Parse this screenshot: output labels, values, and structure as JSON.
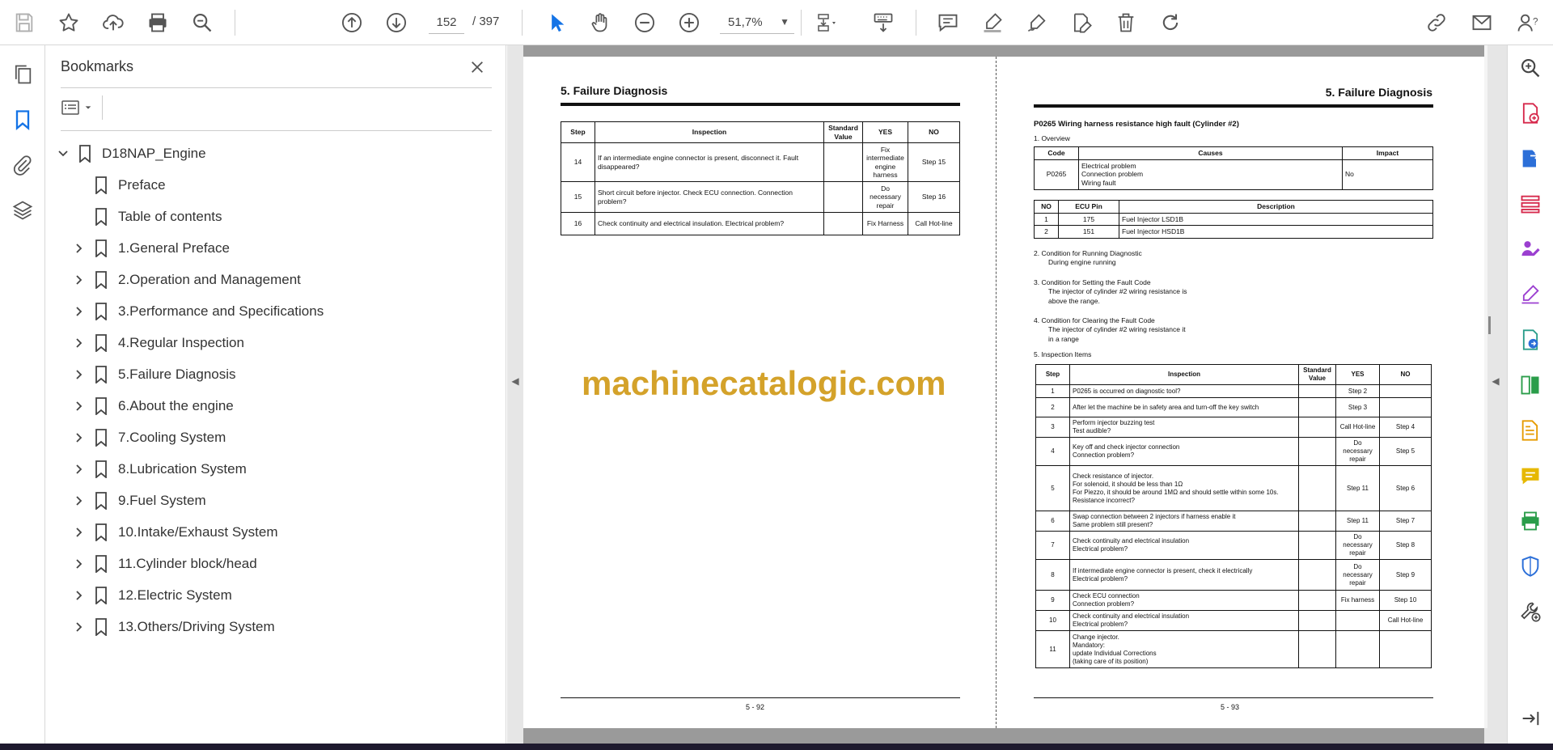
{
  "toolbar": {
    "page_current": "152",
    "page_total": "/  397",
    "zoom": "51,7%"
  },
  "bookmarks": {
    "title": "Bookmarks",
    "items": [
      {
        "label": "D18NAP_Engine",
        "expanded": true,
        "level": 0
      },
      {
        "label": "Preface",
        "level": 1
      },
      {
        "label": "Table of contents",
        "level": 1
      },
      {
        "label": "1.General Preface",
        "level": 1,
        "expandable": true
      },
      {
        "label": "2.Operation and Management",
        "level": 1,
        "expandable": true
      },
      {
        "label": "3.Performance and Specifications",
        "level": 1,
        "expandable": true
      },
      {
        "label": "4.Regular Inspection",
        "level": 1,
        "expandable": true
      },
      {
        "label": "5.Failure Diagnosis",
        "level": 1,
        "expandable": true
      },
      {
        "label": "6.About the engine",
        "level": 1,
        "expandable": true
      },
      {
        "label": "7.Cooling System",
        "level": 1,
        "expandable": true
      },
      {
        "label": "8.Lubrication System",
        "level": 1,
        "expandable": true
      },
      {
        "label": "9.Fuel System",
        "level": 1,
        "expandable": true
      },
      {
        "label": "10.Intake/Exhaust System",
        "level": 1,
        "expandable": true
      },
      {
        "label": "11.Cylinder block/head",
        "level": 1,
        "expandable": true
      },
      {
        "label": "12.Electric System",
        "level": 1,
        "expandable": true
      },
      {
        "label": "13.Others/Driving System",
        "level": 1,
        "expandable": true
      }
    ]
  },
  "left_page": {
    "title": "5. Failure Diagnosis",
    "headers": [
      "Step",
      "Inspection",
      "Standard Value",
      "YES",
      "NO"
    ],
    "rows": [
      {
        "step": "14",
        "inspection": "If an intermediate engine connector is present, disconnect it. Fault disappeared?",
        "std": "",
        "yes": "Fix intermediate engine harness",
        "no": "Step 15"
      },
      {
        "step": "15",
        "inspection": "Short circuit before injector. Check ECU connection. Connection problem?",
        "std": "",
        "yes": "Do necessary repair",
        "no": "Step 16"
      },
      {
        "step": "16",
        "inspection": "Check continuity and electrical insulation. Electrical problem?",
        "std": "",
        "yes": "Fix Harness",
        "no": "Call Hot-line"
      }
    ],
    "page_number": "5 - 92"
  },
  "right_page": {
    "title": "5. Failure Diagnosis",
    "subtitle": "P0265 Wiring harness resistance high fault (Cylinder #2)",
    "overview_label": "1.  Overview",
    "code_table": {
      "headers": [
        "Code",
        "Causes",
        "Impact"
      ],
      "code": "P0265",
      "causes": [
        "Electrical problem",
        "Connection problem",
        "Wiring fault"
      ],
      "impact": "No"
    },
    "pin_table": {
      "headers": [
        "NO",
        "ECU Pin",
        "Description"
      ],
      "rows": [
        {
          "no": "1",
          "pin": "175",
          "desc": "Fuel Injector LSD1B"
        },
        {
          "no": "2",
          "pin": "151",
          "desc": "Fuel Injector HSD1B"
        }
      ]
    },
    "cond_running": [
      "2.  Condition for Running Diagnostic",
      "During engine running"
    ],
    "cond_setting": [
      "3.  Condition for Setting the Fault Code",
      "The injector of cylinder #2 wiring resistance is",
      "above the range."
    ],
    "cond_clearing": [
      "4.  Condition for Clearing the Fault Code",
      "The injector of cylinder #2 wiring resistance it",
      "in a range"
    ],
    "inspection_label": "5.  Inspection Items",
    "inspection_headers": [
      "Step",
      "Inspection",
      "Standard Value",
      "YES",
      "NO"
    ],
    "inspection_rows": [
      {
        "step": "1",
        "inspection": "P0265 is occurred on diagnostic tool?",
        "std": "",
        "yes": "Step 2",
        "no": ""
      },
      {
        "step": "2",
        "inspection": "After let the machine be in safety area and turn-off the key switch",
        "std": "",
        "yes": "Step 3",
        "no": ""
      },
      {
        "step": "3",
        "inspection": "Perform injector buzzing test\nTest audible?",
        "std": "",
        "yes": "Call Hot-line",
        "no": "Step 4"
      },
      {
        "step": "4",
        "inspection": "Key off and check injector connection\nConnection problem?",
        "std": "",
        "yes": "Do necessary repair",
        "no": "Step 5"
      },
      {
        "step": "5",
        "inspection": "Check resistance of injector.\nFor solenoid, it should be less than 1Ω\nFor Piezzo, it should be around 1MΩ and should settle within some 10s.\nResistance incorrect?",
        "std": "",
        "yes": "Step 11",
        "no": "Step 6"
      },
      {
        "step": "6",
        "inspection": "Swap connection between 2 injectors if harness enable it\nSame problem still present?",
        "std": "",
        "yes": "Step 11",
        "no": "Step 7"
      },
      {
        "step": "7",
        "inspection": "Check continuity and electrical insulation\nElectrical problem?",
        "std": "",
        "yes": "Do necessary repair",
        "no": "Step 8"
      },
      {
        "step": "8",
        "inspection": "If intermediate engine connector is present, check it electrically\nElectrical problem?",
        "std": "",
        "yes": "Do necessary repair",
        "no": "Step 9"
      },
      {
        "step": "9",
        "inspection": "Check ECU connection\nConnection problem?",
        "std": "",
        "yes": "Fix harness",
        "no": "Step 10"
      },
      {
        "step": "10",
        "inspection": "Check continuity and electrical insulation\nElectrical problem?",
        "std": "",
        "yes": "",
        "no": "Call Hot-line"
      },
      {
        "step": "11",
        "inspection": "Change injector.\nMandatory:\nupdate Individual Corrections\n(taking care of its position)",
        "std": "",
        "yes": "",
        "no": ""
      }
    ],
    "page_number": "5 - 93"
  },
  "watermark": "machinecatalogic.com",
  "colors": {
    "accent_blue": "#1473e6",
    "icon_gray": "#6e6e6e",
    "rail_magenta": "#d6294c",
    "rail_blue": "#2c6fd8",
    "rail_purple": "#9b3fd0",
    "rail_green": "#2a9d4a",
    "rail_orange": "#e69b00",
    "watermark": "#d4a22a"
  }
}
